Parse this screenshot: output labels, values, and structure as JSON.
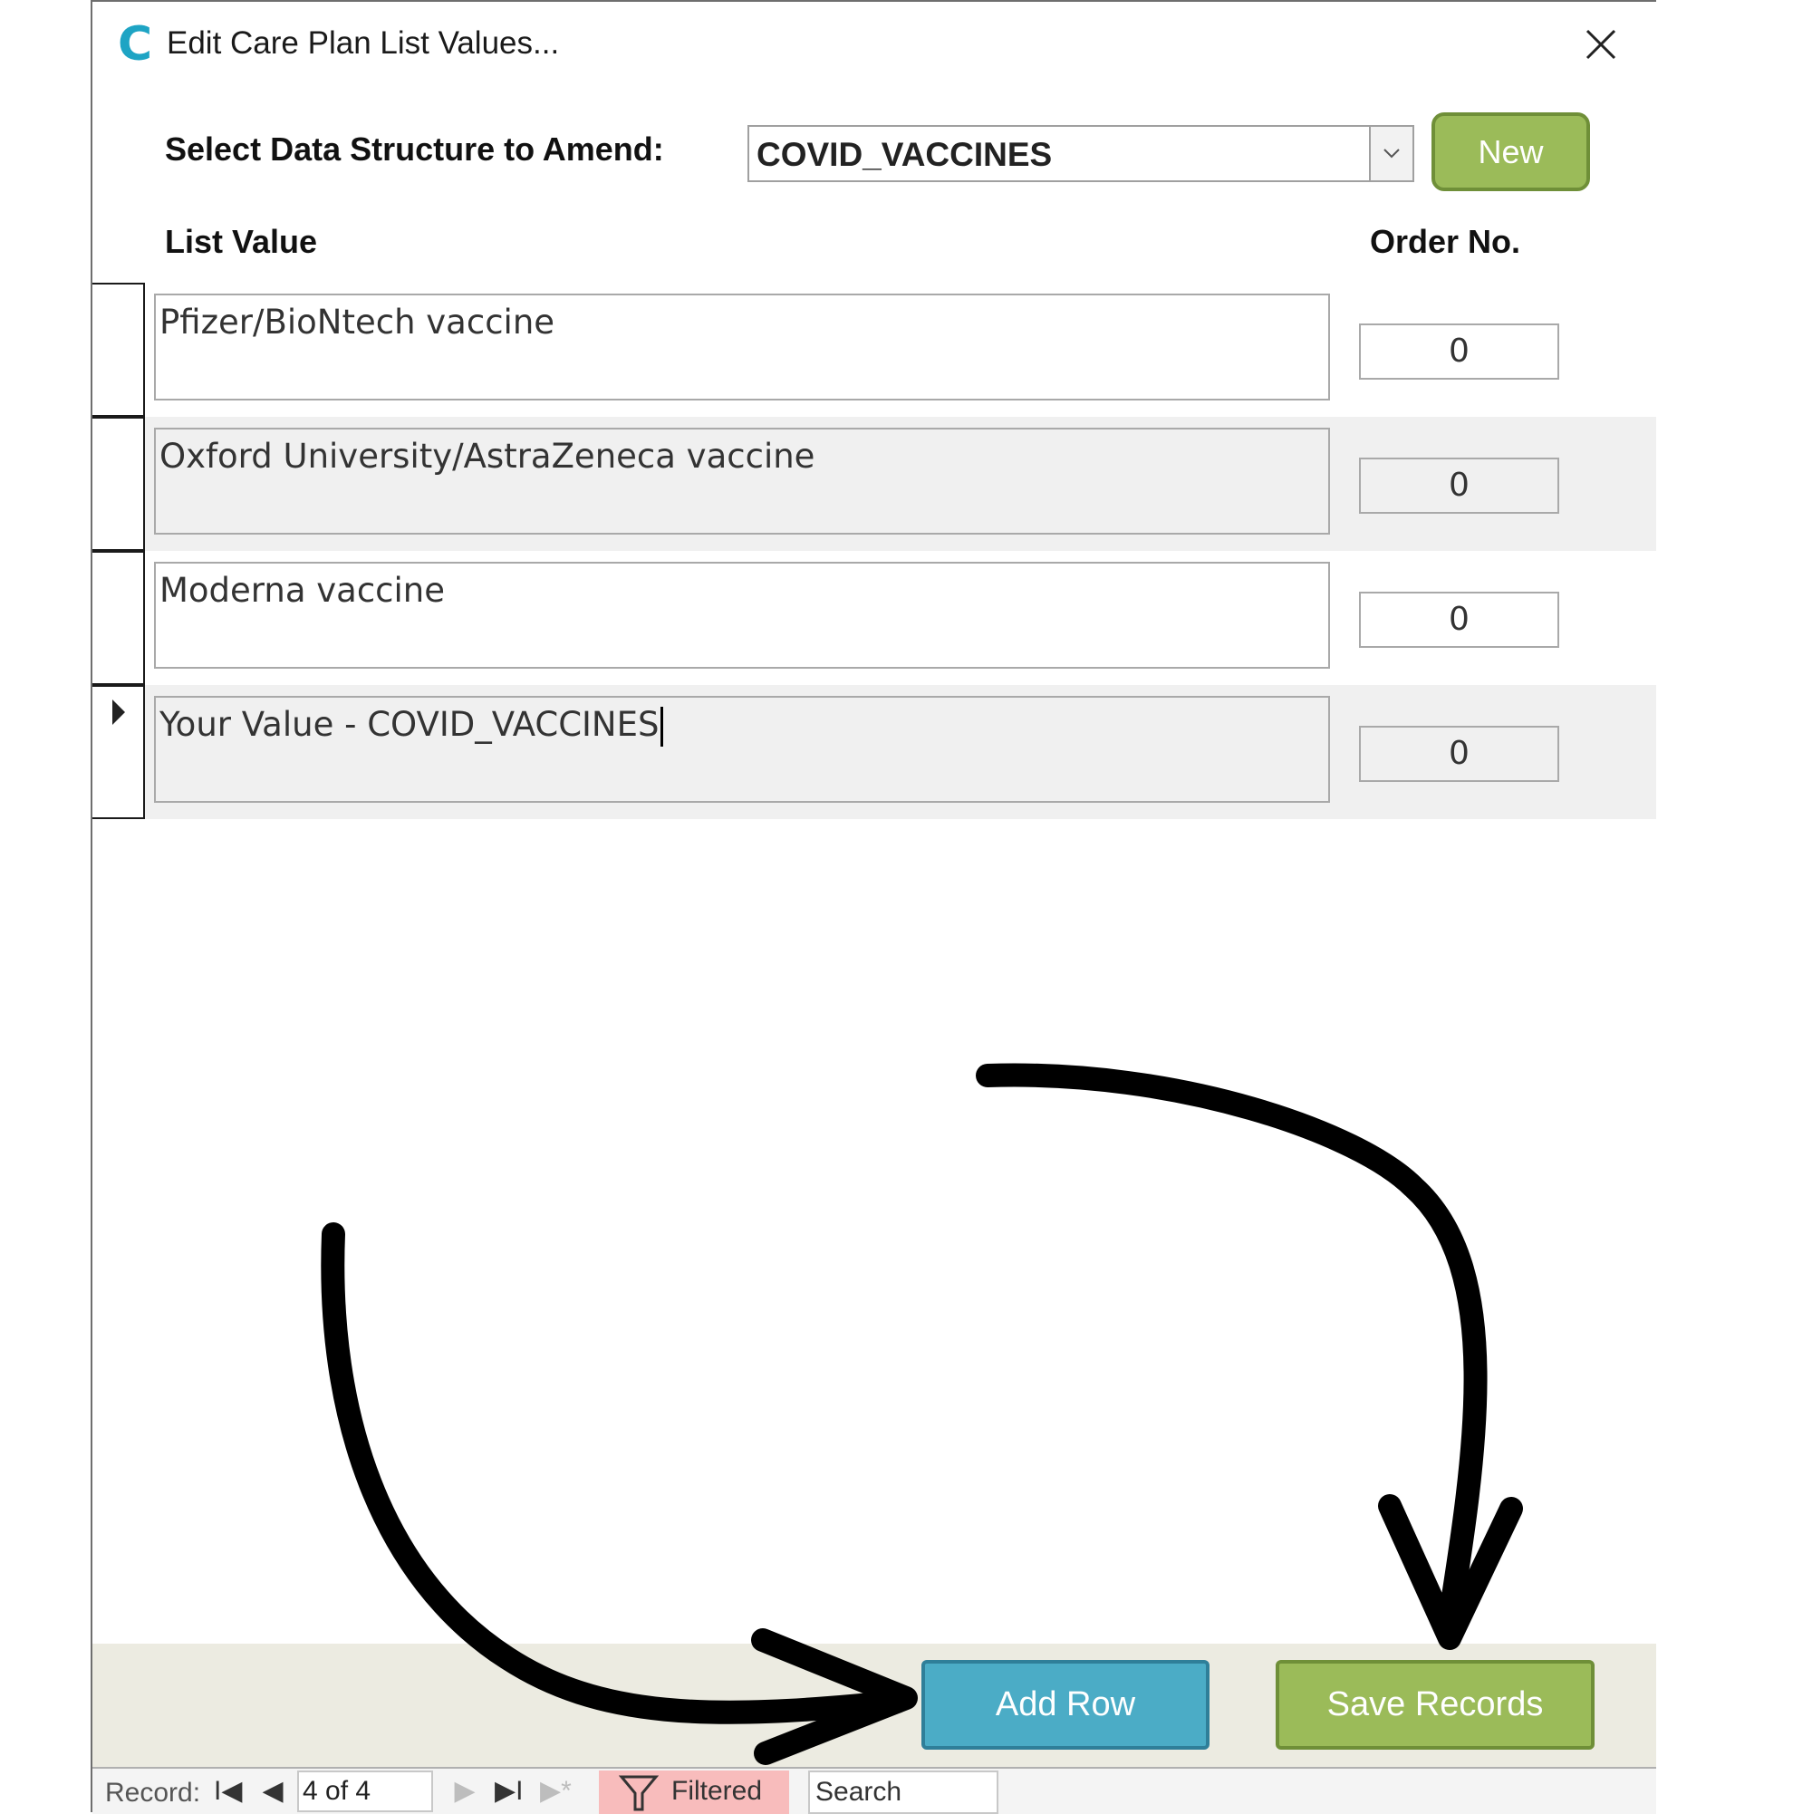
{
  "window": {
    "title": "Edit Care Plan List Values...",
    "logo": "C",
    "close_icon": "×"
  },
  "selector": {
    "label": "Select Data Structure to Amend:",
    "value": "COVID_VACCINES",
    "new_label": "New"
  },
  "columns": {
    "list_value": "List Value",
    "order_no": "Order No."
  },
  "rows": [
    {
      "value": "Pfizer/BioNtech vaccine",
      "order": "0"
    },
    {
      "value": "Oxford University/AstraZeneca vaccine",
      "order": "0"
    },
    {
      "value": "Moderna vaccine",
      "order": "0"
    },
    {
      "value": "Your Value - COVID_VACCINES",
      "order": "0"
    }
  ],
  "footer": {
    "add_row_label": "Add Row",
    "save_label": "Save Records"
  },
  "navigation": {
    "record_label": "Record:",
    "first": "I◀",
    "prev": "◀",
    "position": "4 of 4",
    "next": "▶",
    "last": "▶I",
    "new": "▶*",
    "filtered_label": "Filtered",
    "search_label": "Search"
  },
  "colors": {
    "accent_green": "#9bbb59",
    "accent_blue": "#4bacc6",
    "logo_teal": "#1ea4c4",
    "filter_pink": "#f8bcbc"
  }
}
